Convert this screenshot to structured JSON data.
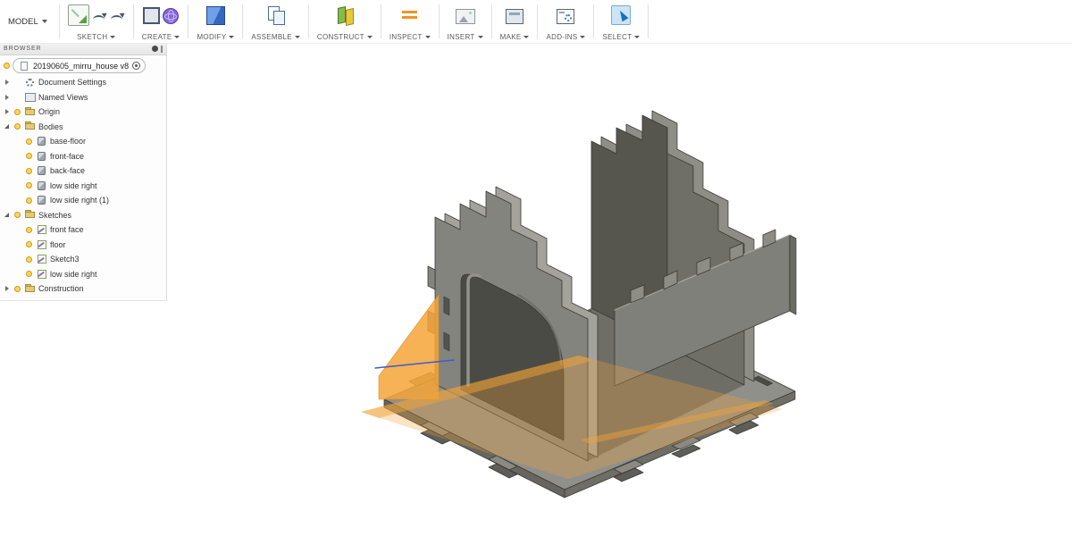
{
  "toolbar": {
    "workspace_label": "MODEL",
    "groups": [
      {
        "label": "SKETCH",
        "icons": [
          "sketch-pencil",
          "spline",
          "spline2"
        ]
      },
      {
        "label": "CREATE",
        "icons": [
          "create-box",
          "create-sphere"
        ]
      },
      {
        "label": "MODIFY",
        "icons": [
          "modify-cube"
        ]
      },
      {
        "label": "ASSEMBLE",
        "icons": [
          "assemble-pages"
        ]
      },
      {
        "label": "CONSTRUCT",
        "icons": [
          "construct-planes"
        ]
      },
      {
        "label": "INSPECT",
        "icons": [
          "inspect-measure"
        ]
      },
      {
        "label": "INSERT",
        "icons": [
          "insert-image"
        ]
      },
      {
        "label": "MAKE",
        "icons": [
          "make-print"
        ]
      },
      {
        "label": "ADD-INS",
        "icons": [
          "addins-gear"
        ]
      },
      {
        "label": "SELECT",
        "icons": [
          "select-cursor"
        ],
        "selected": true
      }
    ]
  },
  "browser": {
    "header": "BROWSER",
    "root": {
      "label": "20190605_mirru_house v8"
    },
    "tree": [
      {
        "label": "Document Settings",
        "level": 1,
        "arrow": "collapsed",
        "bulb": false,
        "icon": "gear"
      },
      {
        "label": "Named Views",
        "level": 1,
        "arrow": "collapsed",
        "bulb": false,
        "icon": "views"
      },
      {
        "label": "Origin",
        "level": 1,
        "arrow": "collapsed",
        "bulb": true,
        "icon": "folder"
      },
      {
        "label": "Bodies",
        "level": 1,
        "arrow": "expanded",
        "bulb": true,
        "icon": "folder"
      },
      {
        "label": "base-floor",
        "level": 2,
        "arrow": null,
        "bulb": true,
        "icon": "body"
      },
      {
        "label": "front-face",
        "level": 2,
        "arrow": null,
        "bulb": true,
        "icon": "body"
      },
      {
        "label": "back-face",
        "level": 2,
        "arrow": null,
        "bulb": true,
        "icon": "body"
      },
      {
        "label": "low side right",
        "level": 2,
        "arrow": null,
        "bulb": true,
        "icon": "body"
      },
      {
        "label": "low side right (1)",
        "level": 2,
        "arrow": null,
        "bulb": true,
        "icon": "body"
      },
      {
        "label": "Sketches",
        "level": 1,
        "arrow": "expanded",
        "bulb": true,
        "icon": "folder"
      },
      {
        "label": "front face",
        "level": 2,
        "arrow": null,
        "bulb": true,
        "icon": "sketch"
      },
      {
        "label": "floor",
        "level": 2,
        "arrow": null,
        "bulb": true,
        "icon": "sketch"
      },
      {
        "label": "Sketch3",
        "level": 2,
        "arrow": null,
        "bulb": true,
        "icon": "sketch"
      },
      {
        "label": "low side right",
        "level": 2,
        "arrow": null,
        "bulb": true,
        "icon": "sketch"
      },
      {
        "label": "Construction",
        "level": 1,
        "arrow": "collapsed",
        "bulb": true,
        "icon": "folder"
      }
    ]
  },
  "viewport": {
    "colors": {
      "wall_gray": "#84847e",
      "wall_dark": "#56564f",
      "floor_gray": "#90908a",
      "outline": "#3a3a36",
      "construction_plane_orange": "#f2a338",
      "sketch_line_blue": "#3b5bd6"
    }
  }
}
